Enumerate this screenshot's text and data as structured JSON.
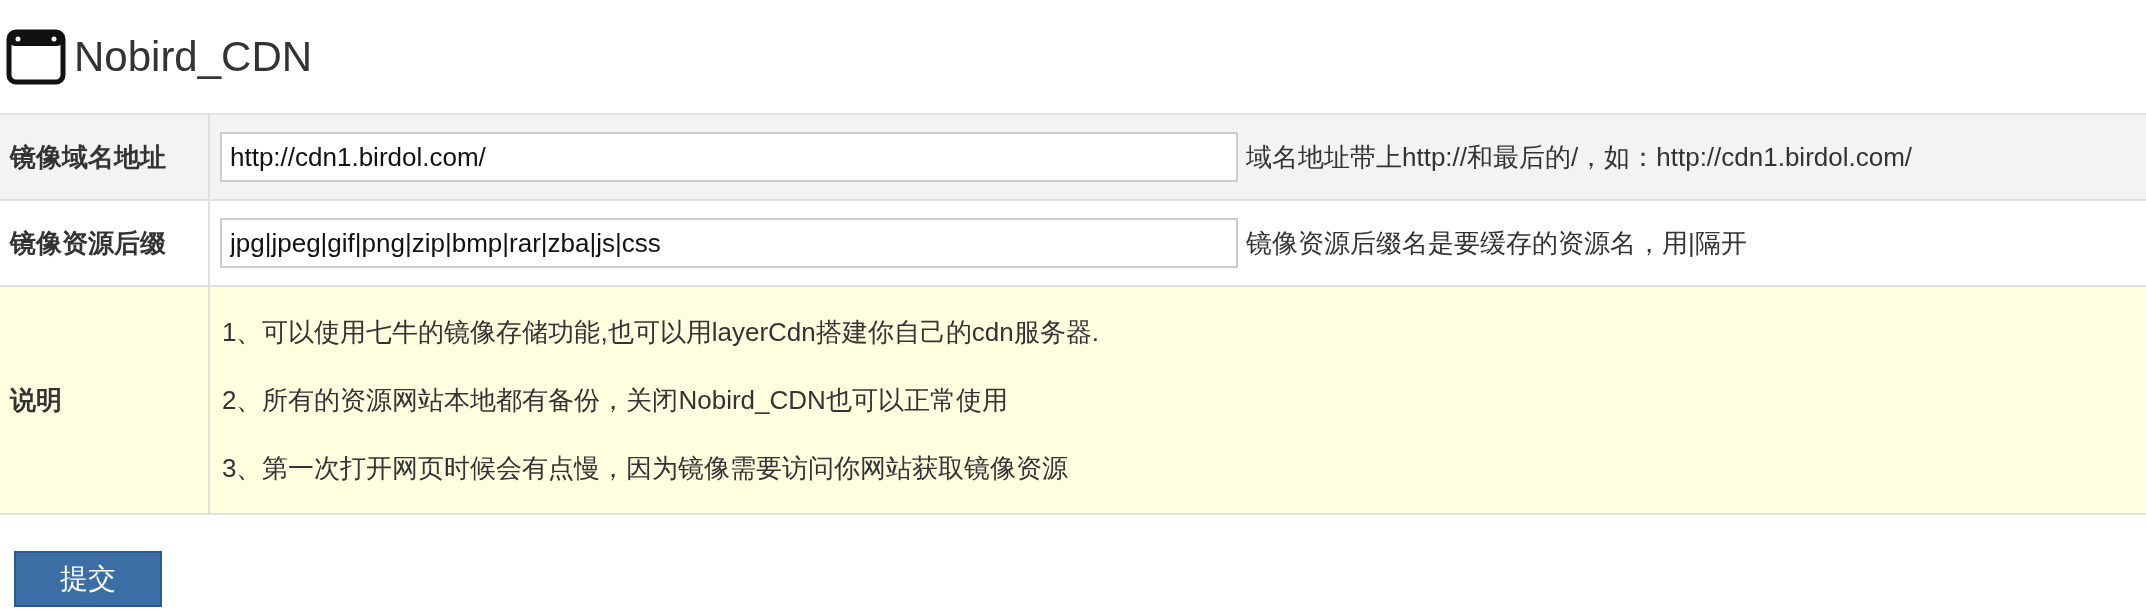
{
  "title": "Nobird_CDN",
  "rows": [
    {
      "kind": "input",
      "label": "镜像域名地址",
      "value": "http://cdn1.birdol.com/",
      "hint": "域名地址带上http://和最后的/，如：http://cdn1.birdol.com/"
    },
    {
      "kind": "input",
      "label": "镜像资源后缀",
      "value": "jpg|jpeg|gif|png|zip|bmp|rar|zba|js|css",
      "hint": "镜像资源后缀名是要缓存的资源名，用|隔开"
    },
    {
      "kind": "notes",
      "label": "说明",
      "lines": [
        "1、可以使用七牛的镜像存储功能,也可以用layerCdn搭建你自己的cdn服务器.",
        "2、所有的资源网站本地都有备份，关闭Nobird_CDN也可以正常使用",
        "3、第一次打开网页时候会有点慢，因为镜像需要访问你网站获取镜像资源"
      ]
    }
  ],
  "submit": "提交"
}
